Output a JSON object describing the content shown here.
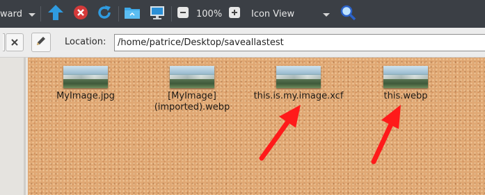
{
  "toolbar": {
    "forward_label": "ward",
    "zoom_label": "100%",
    "view_mode_label": "Icon View"
  },
  "location": {
    "label": "Location:",
    "value": "/home/patrice/Desktop/saveallastest"
  },
  "files": [
    {
      "name_line1": "MyImage.jpg",
      "name_line2": ""
    },
    {
      "name_line1": "[MyImage]",
      "name_line2": "(imported).webp"
    },
    {
      "name_line1": "this.is.my.image.xcf",
      "name_line2": ""
    },
    {
      "name_line1": "this.webp",
      "name_line2": ""
    }
  ],
  "colors": {
    "toolbar_bg": "#3b3f45",
    "accent_blue": "#2f9be0",
    "stop_red": "#d43a3a",
    "arrow_red": "#ff1a1a",
    "cork": "#e0a874"
  }
}
